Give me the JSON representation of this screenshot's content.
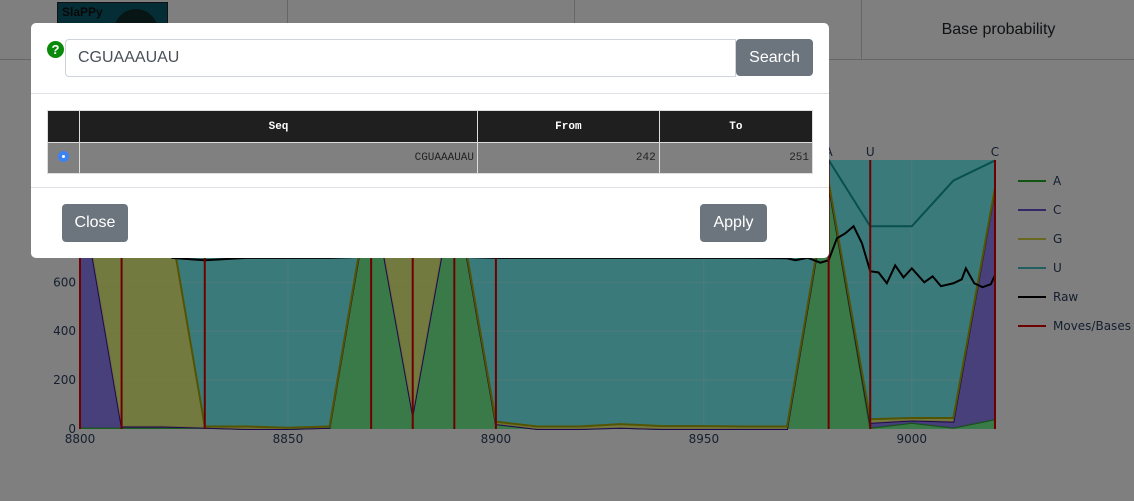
{
  "header": {
    "logo_text": "SlaPPy",
    "tabs": [
      {
        "label": ""
      },
      {
        "label": ""
      },
      {
        "label": "Base probability"
      }
    ]
  },
  "modal": {
    "search_value": "CGUAAAUAU",
    "search_label": "Search",
    "help_icon": "question-circle-icon",
    "table": {
      "columns": [
        "",
        "Seq",
        "From",
        "To"
      ],
      "rows": [
        {
          "selected": true,
          "seq": "CGUAAAUAU",
          "from": "242",
          "to": "251"
        }
      ]
    },
    "close_label": "Close",
    "apply_label": "Apply"
  },
  "chart_data": {
    "type": "area",
    "x": [
      8800,
      8810,
      8820,
      8830,
      8840,
      8850,
      8860,
      8870,
      8880,
      8890,
      8900,
      8910,
      8920,
      8930,
      8940,
      8950,
      8960,
      8970,
      8980,
      8990,
      9000,
      9010,
      9020
    ],
    "series": [
      {
        "name": "A",
        "color": "#22aa22",
        "values": [
          5,
          5,
          5,
          5,
          0,
          0,
          5,
          1000,
          60,
          1000,
          20,
          0,
          0,
          5,
          0,
          0,
          0,
          0,
          1000,
          5,
          25,
          5,
          40
        ]
      },
      {
        "name": "C",
        "color": "#3a10a0",
        "values": [
          1000,
          5,
          5,
          0,
          0,
          0,
          0,
          0,
          0,
          0,
          0,
          0,
          0,
          0,
          0,
          0,
          0,
          0,
          0,
          20,
          10,
          25,
          940
        ]
      },
      {
        "name": "G",
        "color": "#a8a800",
        "values": [
          0,
          1000,
          1000,
          5,
          10,
          5,
          5,
          10,
          900,
          10,
          10,
          10,
          10,
          15,
          12,
          12,
          10,
          10,
          10,
          15,
          10,
          15,
          5
        ]
      },
      {
        "name": "U",
        "color": "#10a0a0",
        "values": [
          90,
          90,
          90,
          1090,
          1090,
          1095,
          1090,
          90,
          140,
          90,
          1070,
          1090,
          1090,
          1080,
          1088,
          1088,
          1090,
          1090,
          90,
          789,
          784,
          971,
          113
        ]
      },
      {
        "name": "Raw",
        "color": "#000000",
        "x": [
          8822,
          8830,
          8840,
          8860,
          8880,
          8900,
          8920,
          8940,
          8960,
          8970,
          8972,
          8975,
          8978,
          8980,
          8982,
          8984,
          8986,
          8988,
          8990,
          8992,
          8994,
          8996,
          8998,
          9000,
          9003,
          9005,
          9007,
          9010,
          9012,
          9013,
          9015,
          9017,
          9019,
          9020
        ],
        "values": [
          700,
          690,
          700,
          700,
          710,
          700,
          700,
          700,
          700,
          698,
          690,
          700,
          680,
          690,
          780,
          800,
          829,
          760,
          645,
          640,
          596,
          669,
          620,
          657,
          600,
          624,
          584,
          596,
          612,
          657,
          596,
          580,
          592,
          629
        ]
      },
      {
        "name": "Moves/Bases",
        "color": "#dd0000",
        "x": [
          8800,
          8810,
          8830,
          8870,
          8880,
          8890,
          8900,
          8980,
          8990,
          9020
        ]
      }
    ],
    "base_labels": [
      {
        "x": 8980,
        "label": "A"
      },
      {
        "x": 8990,
        "label": "U"
      },
      {
        "x": 9020,
        "label": "C"
      }
    ],
    "xlim": [
      8800,
      9020
    ],
    "ylim": [
      0,
      1100
    ],
    "xticks": [
      "8800",
      "8850",
      "8900",
      "8950",
      "9000"
    ],
    "yticks": [
      "0",
      "200",
      "400",
      "600"
    ],
    "legend_position": "right",
    "plot_background": "#74f4f4"
  }
}
